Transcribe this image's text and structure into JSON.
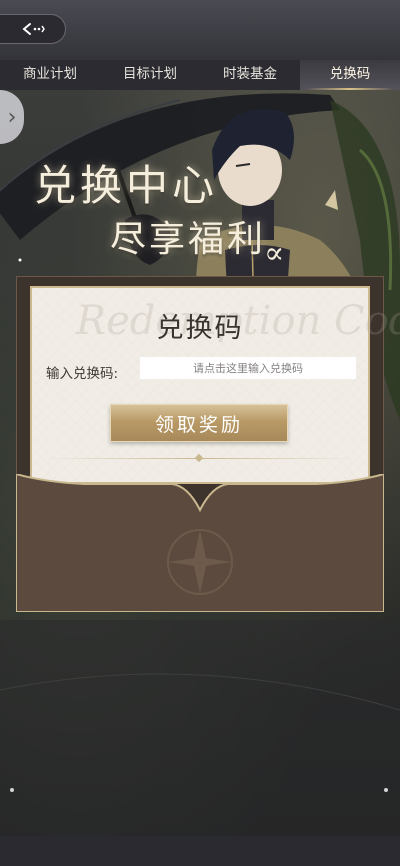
{
  "header": {
    "back_icon": "back-arrow-icon"
  },
  "tabs": [
    {
      "label": "商业计划",
      "active": false
    },
    {
      "label": "目标计划",
      "active": false
    },
    {
      "label": "时装基金",
      "active": false
    },
    {
      "label": "兑换码",
      "active": true
    }
  ],
  "banner": {
    "title_line1": "兑换中心",
    "title_line2": "尽享福利",
    "mark": "∝"
  },
  "card": {
    "title": "兑换码",
    "watermark": "Redemption Code",
    "input_label": "输入兑换码:",
    "input_placeholder": "请点击这里输入兑换码",
    "input_value": "",
    "claim_label": "领取奖励"
  },
  "colors": {
    "accent_gold": "#c9b88f",
    "card_bg": "#f1ede6",
    "envelope": "#5c4a3e"
  }
}
